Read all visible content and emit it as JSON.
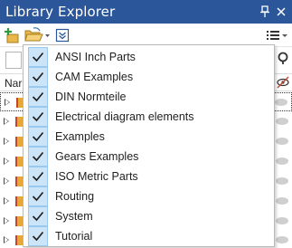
{
  "window": {
    "title": "Library Explorer"
  },
  "toolbar": {
    "add_icon": "add-library-icon",
    "open_icon": "open-folder-icon",
    "expand_icon": "expand-icon",
    "view_icon": "view-options-icon"
  },
  "header": {
    "name_column": "Nar"
  },
  "menu": {
    "items": [
      {
        "label": "ANSI Inch Parts",
        "checked": true
      },
      {
        "label": "CAM Examples",
        "checked": true
      },
      {
        "label": "DIN Normteile",
        "checked": true
      },
      {
        "label": "Electrical diagram elements",
        "checked": true
      },
      {
        "label": "Examples",
        "checked": true
      },
      {
        "label": "Gears Examples",
        "checked": true
      },
      {
        "label": "ISO Metric Parts",
        "checked": true
      },
      {
        "label": "Routing",
        "checked": true
      },
      {
        "label": "System",
        "checked": true
      },
      {
        "label": "Tutorial",
        "checked": true
      }
    ]
  },
  "colors": {
    "titlebar": "#2b579a",
    "check_highlight": "#cce4f7",
    "check_border": "#99c9ef"
  }
}
